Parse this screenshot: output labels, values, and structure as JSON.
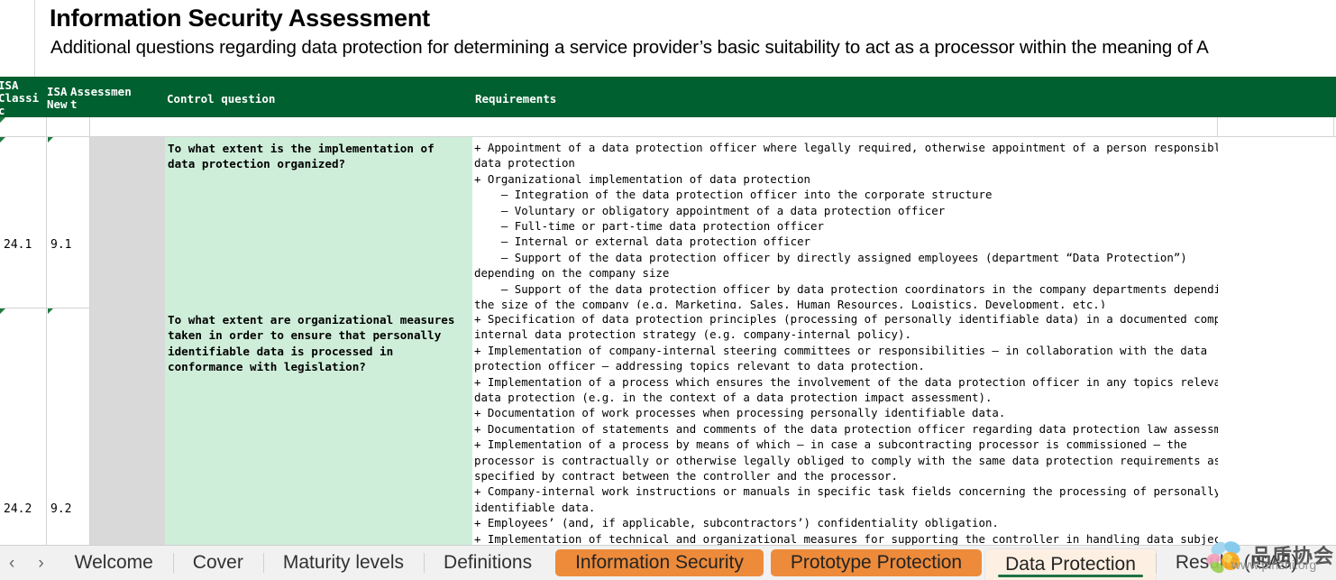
{
  "document": {
    "title": "Information Security Assessment",
    "subtitle": "Additional questions regarding data protection for determining a service provider’s basic suitability to act as a processor within the meaning of A"
  },
  "table": {
    "headers": {
      "isa_classic": "ISA\nClassi\nc",
      "isa_new": "ISA\nNew",
      "assessment": "Assessmen\nt",
      "control_question": "Control question",
      "requirements": "Requirements"
    },
    "rows": [
      {
        "isa_classic": "24.1",
        "isa_new": "9.1",
        "assessment": "",
        "control_question": "To what extent is the implementation of\ndata protection organized?",
        "requirements": "+ Appointment of a data protection officer where legally required, otherwise appointment of a person responsible for\ndata protection\n+ Organizational implementation of data protection\n    – Integration of the data protection officer into the corporate structure\n    – Voluntary or obligatory appointment of a data protection officer\n    – Full-time or part-time data protection officer\n    – Internal or external data protection officer\n    – Support of the data protection officer by directly assigned employees (department “Data Protection”)\ndepending on the company size\n    – Support of the data protection officer by data protection coordinators in the company departments depending on\nthe size of the company (e.g. Marketing, Sales, Human Resources, Logistics, Development, etc.)"
      },
      {
        "isa_classic": "24.2",
        "isa_new": "9.2",
        "assessment": "",
        "control_question": "To what extent are organizational measures\ntaken in order to ensure that personally\nidentifiable data is processed in\nconformance with legislation?",
        "requirements": "+ Specification of data protection principles (processing of personally identifiable data) in a documented company-\ninternal data protection strategy (e.g. company-internal policy).\n+ Implementation of company-internal steering committees or responsibilities – in collaboration with the data\nprotection officer – addressing topics relevant to data protection.\n+ Implementation of a process which ensures the involvement of the data protection officer in any topics relevant to\ndata protection (e.g. in the context of a data protection impact assessment).\n+ Documentation of work processes when processing personally identifiable data.\n+ Documentation of statements and comments of the data protection officer regarding data protection law assessments.\n+ Implementation of a process by means of which – in case a subcontracting processor is commissioned – the\nprocessor is contractually or otherwise legally obliged to comply with the same data protection requirements as\nspecified by contract between the controller and the processor.\n+ Company-internal work instructions or manuals in specific task fields concerning the processing of personally\nidentifiable data.\n+ Employees’ (and, if applicable, subcontractors’) confidentiality obligation.\n+ Implementation of technical and organizational measures for supporting the controller in handling data subject\nrights as far as feasible and appropriate for processing"
      }
    ]
  },
  "tabbar": {
    "nav": {
      "prev_icon": "‹",
      "next_icon": "›"
    },
    "tabs": [
      {
        "label": "Welcome",
        "state": "normal"
      },
      {
        "label": "Cover",
        "state": "normal"
      },
      {
        "label": "Maturity levels",
        "state": "normal"
      },
      {
        "label": "Definitions",
        "state": "normal"
      },
      {
        "label": "Information Security",
        "state": "orange"
      },
      {
        "label": "Prototype Protection",
        "state": "orange"
      },
      {
        "label": "Data Protection",
        "state": "active"
      },
      {
        "label": "Results (ISA5)",
        "state": "normal"
      }
    ]
  },
  "watermark": {
    "chinese": "品质协会",
    "url": "www.pinzhi.org"
  },
  "colors": {
    "header_green": "#00602F",
    "question_green": "#CFEEDA",
    "assessment_gray": "#D9D9D9",
    "tab_orange": "#ED8B3B",
    "tab_active_bg": "#FDF0E2",
    "tab_active_underline": "#1E7145"
  }
}
